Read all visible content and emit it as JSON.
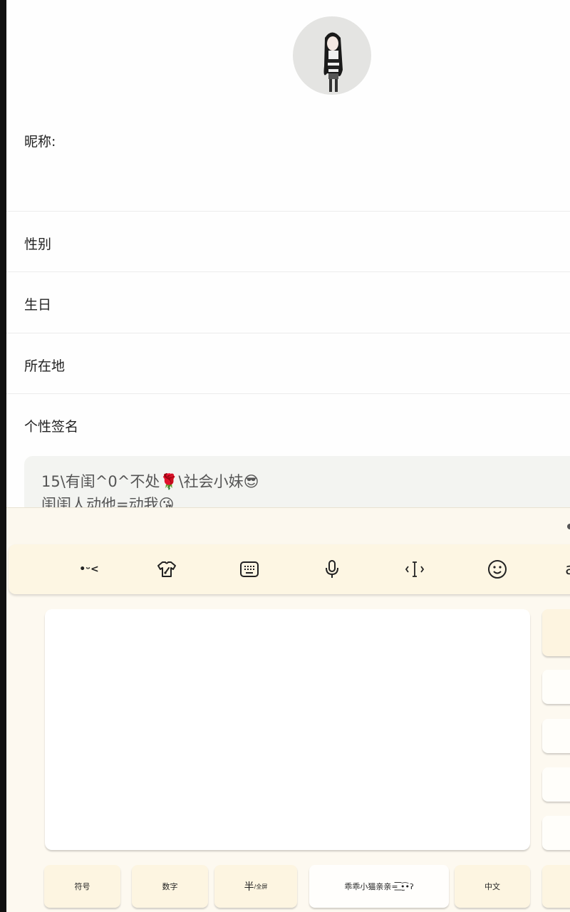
{
  "profile": {
    "nickname_label": "昵称:",
    "gender_label": "性别",
    "birthday_label": "生日",
    "location_label": "所在地",
    "signature_label": "个性签名",
    "signature_lines": [
      "15\\有闺^0^不处🌹\\社会小妹😎",
      "闺闺人动他=动我😘"
    ]
  },
  "keyboard": {
    "toolbar": {
      "kaomoji_label": "•ᵕ<",
      "icons": [
        "skin-icon",
        "keyboard-icon",
        "microphone-icon",
        "text-cursor-icon",
        "emoji-icon"
      ]
    },
    "bottom_row": {
      "symbol_label": "符号",
      "number_label": "数字",
      "half_label": "半",
      "fullscreen_label": "/全屏",
      "space_label": "乖乖小猫亲亲=͟͟͞͞ •̫͡•ʔ",
      "chinese_label": "中文"
    }
  }
}
